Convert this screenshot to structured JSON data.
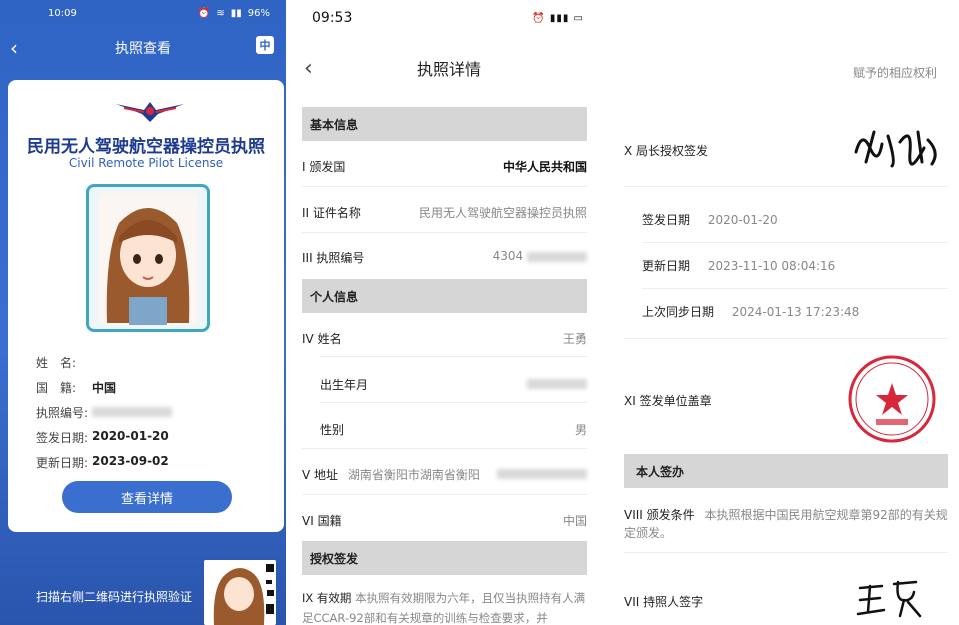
{
  "panel1": {
    "status": {
      "time": "10:09",
      "battery": "96%"
    },
    "nav": {
      "title": "执照查看",
      "lang_icon_text": "中"
    },
    "card": {
      "title": "民用无人驾驶航空器操控员执照",
      "subtitle": "Civil Remote Pilot License",
      "fields": [
        {
          "label": "姓　名:",
          "value": ""
        },
        {
          "label": "国　籍:",
          "value": "中国"
        },
        {
          "label": "执照编号:",
          "value": ""
        },
        {
          "label": "签发日期:",
          "value": "2020-01-20"
        },
        {
          "label": "更新日期:",
          "value": "2023-09-02"
        }
      ],
      "details_button": "查看详情"
    },
    "hint": "扫描右侧二维码进行执照验证"
  },
  "panel2": {
    "status": {
      "time": "09:53"
    },
    "nav": {
      "title": "执照详情"
    },
    "sections": {
      "basic": "基本信息",
      "personal": "个人信息",
      "auth": "授权签发"
    },
    "rows": {
      "issuing_country": {
        "label": "I 颁发国",
        "value": "中华人民共和国"
      },
      "license_name": {
        "label": "II 证件名称",
        "value": "民用无人驾驶航空器操控员执照"
      },
      "license_no": {
        "label": "III 执照编号",
        "value": "4304"
      },
      "name": {
        "label": "IV 姓名",
        "value": "王勇"
      },
      "birth": {
        "label": "出生年月",
        "value": ""
      },
      "gender": {
        "label": "性别",
        "value": "男"
      },
      "address": {
        "label": "V 地址",
        "value": "湖南省衡阳市湖南省衡阳"
      },
      "nationality": {
        "label": "VI 国籍",
        "value": "中国"
      }
    },
    "validity": {
      "label": "IX 有效期",
      "text": "本执照有效期限为六年，且仅当执照持有人满足CCAR-92部和有关规章的训练与检查要求，并"
    }
  },
  "panel3": {
    "top_text": "赋予的相应权利",
    "director_sign": {
      "label": "X 局长授权签发"
    },
    "dates": [
      {
        "label": "签发日期",
        "value": "2020-01-20"
      },
      {
        "label": "更新日期",
        "value": "2023-11-10 08:04:16"
      },
      {
        "label": "上次同步日期",
        "value": "2024-01-13 17:23:48"
      }
    ],
    "stamp": {
      "label": "XI 签发单位盖章"
    },
    "section_self": "本人签办",
    "conditions": {
      "label": "VIII 颁发条件",
      "value": "本执照根据中国民用航空规章第92部的有关规定颁发。"
    },
    "holder_sign": {
      "label": "VII 持照人签字"
    }
  },
  "colors": {
    "primary": "#2f63c4",
    "section_bg": "#d6d6d6",
    "stamp_red": "#d8263a"
  }
}
